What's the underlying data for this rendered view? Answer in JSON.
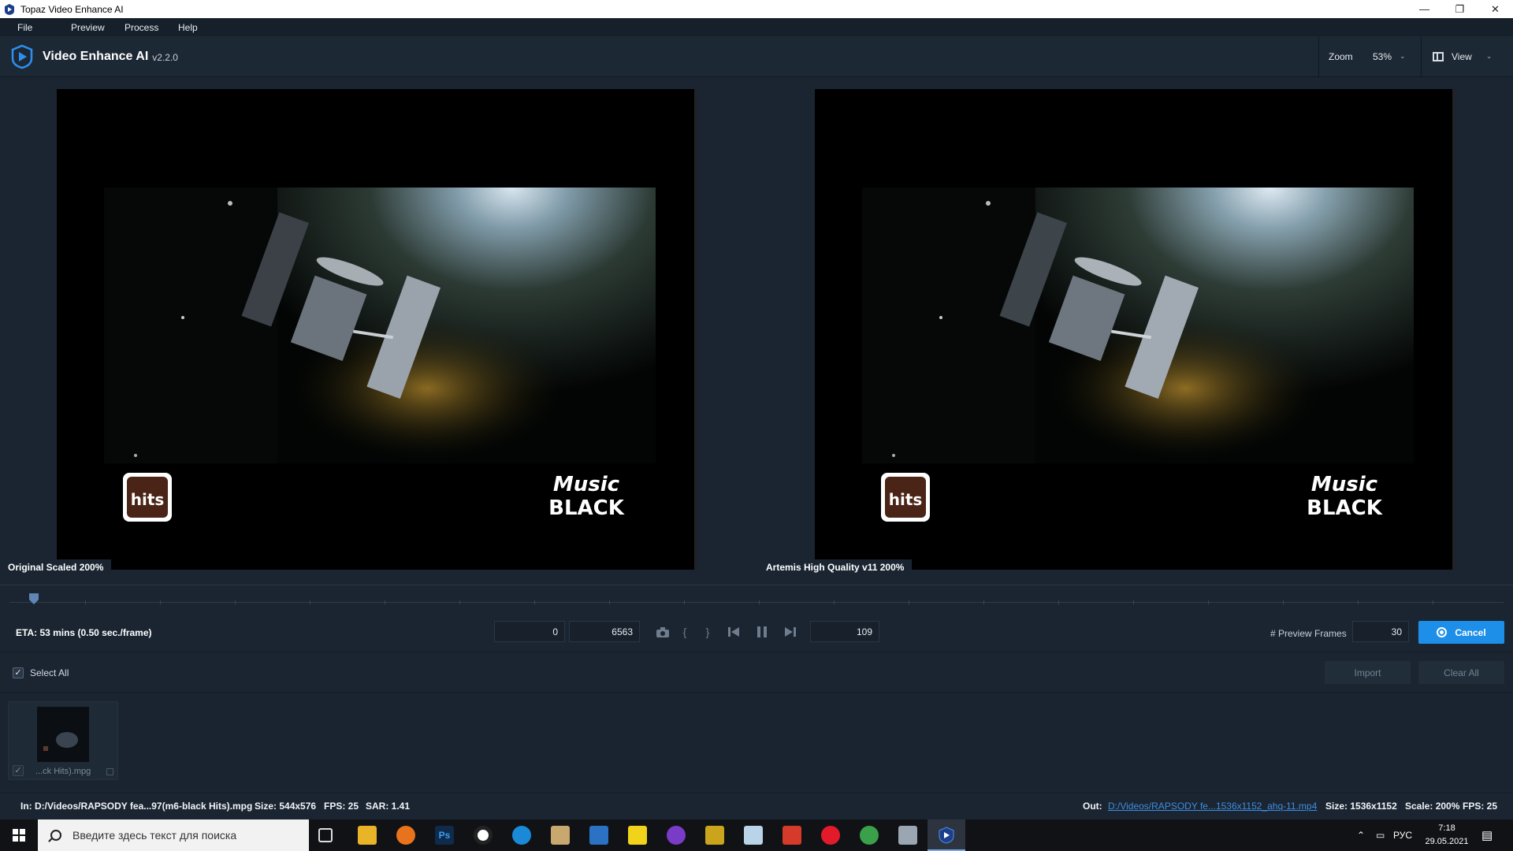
{
  "window": {
    "title": "Topaz Video Enhance AI",
    "minimize": "—",
    "restore": "❐",
    "close": "✕"
  },
  "menu": [
    "File",
    "Preview",
    "Process",
    "Help"
  ],
  "header": {
    "brand": "Video Enhance AI",
    "version": "v2.2.0",
    "zoom_label": "Zoom",
    "zoom_value": "53%",
    "view_label": "View"
  },
  "preview": {
    "left_caption": "Original Scaled 200%",
    "right_caption": "Artemis High Quality v11 200%",
    "logo_left_text": "hits",
    "logo_right_line1": "Music",
    "logo_right_line2": "BLACK"
  },
  "controls": {
    "eta": "ETA:  53 mins  (0.50 sec./frame)",
    "start_frame": "0",
    "end_frame": "6563",
    "current_frame": "109",
    "preview_frames_label": "# Preview Frames",
    "preview_frames_value": "30",
    "cancel_label": "Cancel"
  },
  "queue": {
    "select_all_label": "Select All",
    "import_label": "Import",
    "clear_all_label": "Clear All",
    "items": [
      {
        "name": "...ck Hits).mpg"
      }
    ]
  },
  "status": {
    "in_path": "In: D:/Videos/RAPSODY fea...97(m6-black Hits).mpg",
    "in_size": "Size: 544x576",
    "in_fps": "FPS: 25",
    "in_sar": "SAR: 1.41",
    "out_label": "Out:",
    "out_path": "D:/Videos/RAPSODY fe...1536x1152_ahq-11.mp4",
    "out_size": "Size: 1536x1152",
    "out_scale": "Scale: 200%",
    "out_fps": "FPS: 25"
  },
  "taskbar": {
    "search_placeholder": "Введите здесь текст для поиска",
    "language": "РУС",
    "time": "7:18",
    "date": "29.05.2021"
  }
}
